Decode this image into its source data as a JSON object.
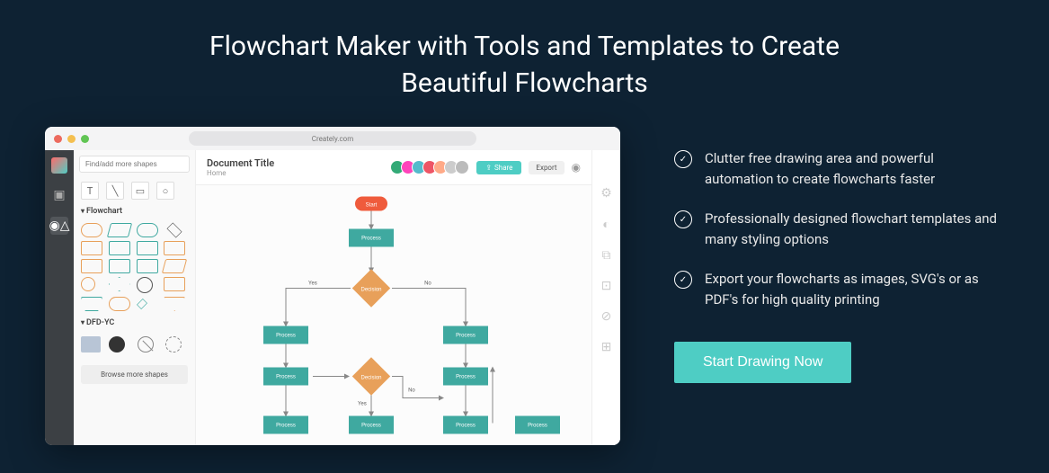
{
  "page_title": "Flowchart Maker with Tools and Templates to Create Beautiful Flowcharts",
  "app": {
    "url": "Creately.com",
    "doc_title": "Document Title",
    "home": "Home",
    "share": "Share",
    "export": "Export",
    "search_placeholder": "Find/add more shapes",
    "cat_flowchart": "Flowchart",
    "cat_dfd": "DFD-YC",
    "browse": "Browse more shapes",
    "avatars": [
      "#3a7",
      "#f4b",
      "#5bc",
      "#e56",
      "#fa8",
      "#ccc",
      "#bbb"
    ]
  },
  "flow": {
    "start": "Start",
    "process": "Process",
    "decision": "Decision",
    "yes": "Yes",
    "no": "No"
  },
  "features": [
    "Clutter free drawing area and powerful automation to create flowcharts faster",
    "Professionally designed flowchart templates and many styling options",
    "Export your flowcharts as images, SVG's or as PDF's for high quality printing"
  ],
  "cta": "Start Drawing Now"
}
